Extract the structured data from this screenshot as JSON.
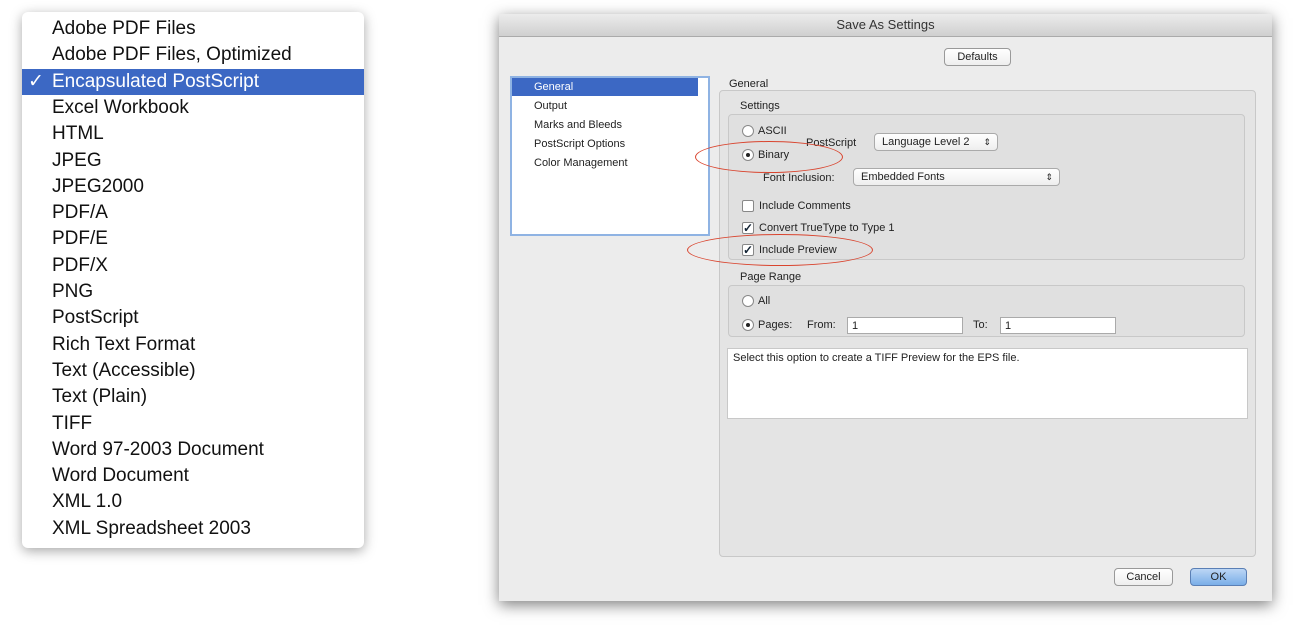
{
  "format_menu": {
    "selected_index": 2,
    "check_glyph": "✓",
    "items": [
      "Adobe PDF Files",
      "Adobe PDF Files, Optimized",
      "Encapsulated PostScript",
      "Excel Workbook",
      "HTML",
      "JPEG",
      "JPEG2000",
      "PDF/A",
      "PDF/E",
      "PDF/X",
      "PNG",
      "PostScript",
      "Rich Text Format",
      "Text (Accessible)",
      "Text (Plain)",
      "TIFF",
      "Word 97-2003 Document",
      "Word Document",
      "XML 1.0",
      "XML Spreadsheet 2003"
    ]
  },
  "dialog": {
    "title": "Save As Settings",
    "defaults_label": "Defaults",
    "categories": [
      "General",
      "Output",
      "Marks and Bleeds",
      "PostScript Options",
      "Color Management"
    ],
    "selected_category": 0,
    "section_title": "General",
    "settings": {
      "label": "Settings",
      "ascii": "ASCII",
      "binary": "Binary",
      "encoding_selected": "Binary",
      "postscript_label": "PostScript",
      "postscript_value": "Language Level 2",
      "font_inclusion_label": "Font Inclusion:",
      "font_inclusion_value": "Embedded Fonts",
      "include_comments": "Include Comments",
      "include_comments_checked": false,
      "convert_truetype": "Convert TrueType to Type 1",
      "convert_truetype_checked": true,
      "include_preview": "Include Preview",
      "include_preview_checked": true
    },
    "page_range": {
      "label": "Page Range",
      "all": "All",
      "pages": "Pages:",
      "selected": "Pages",
      "from_label": "From:",
      "from_value": "1",
      "to_label": "To:",
      "to_value": "1"
    },
    "description": "Select this option to create a TIFF Preview for the EPS file.",
    "cancel_label": "Cancel",
    "ok_label": "OK",
    "annotation_color": "#d9442e"
  }
}
